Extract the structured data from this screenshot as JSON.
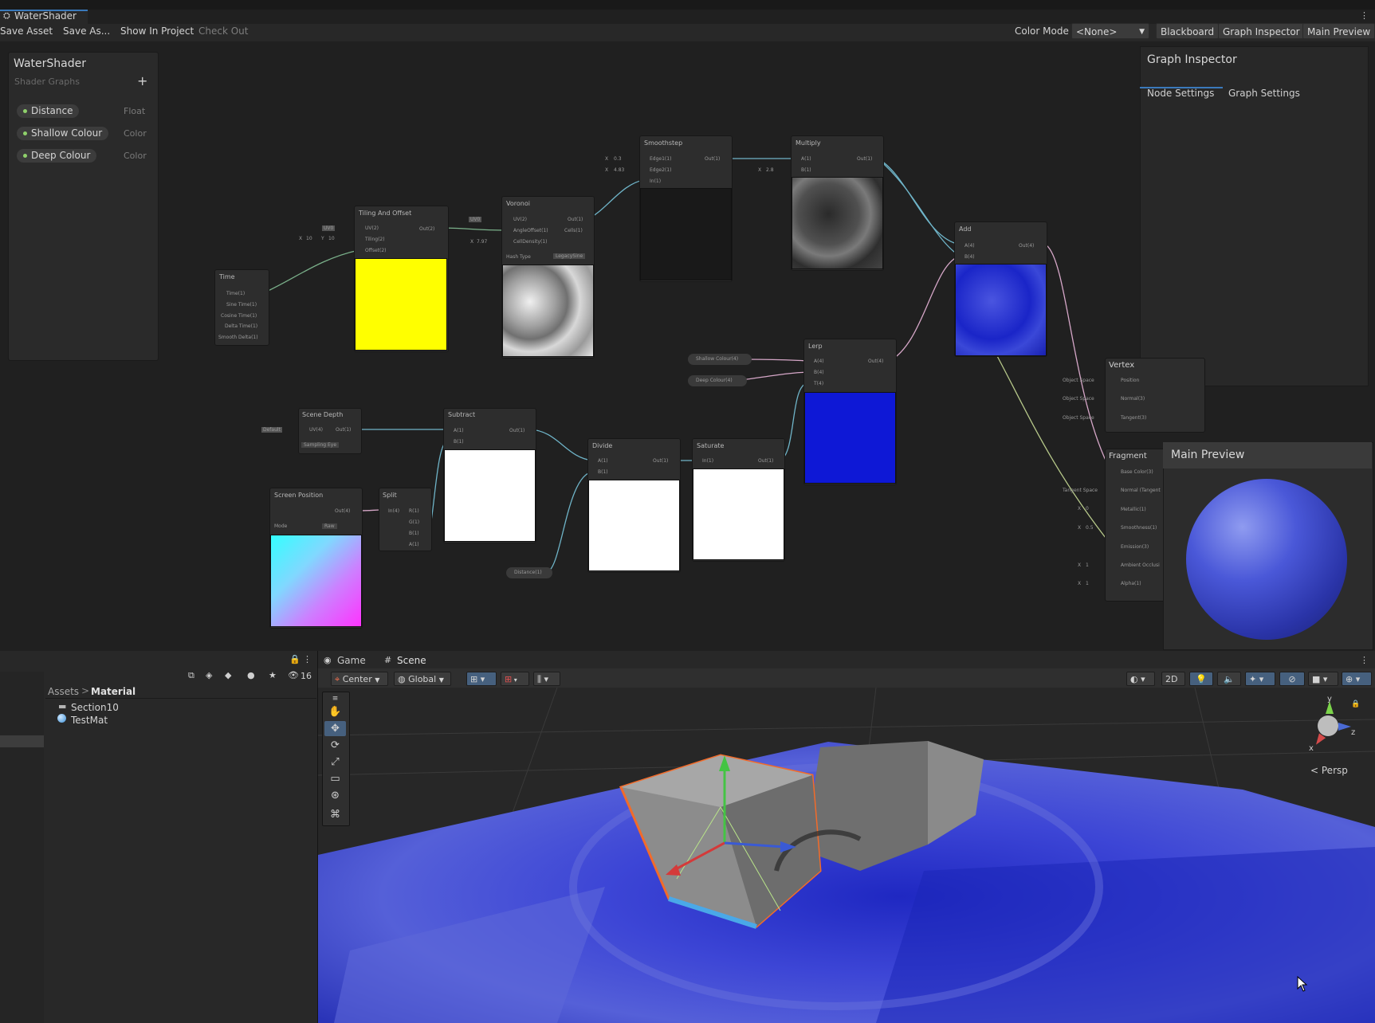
{
  "window": {
    "title": "WaterShader"
  },
  "toolbar": {
    "save_asset": "Save Asset",
    "save_as": "Save As...",
    "show_in_project": "Show In Project",
    "check_out": "Check Out",
    "color_mode_label": "Color Mode",
    "color_mode_value": "<None>",
    "blackboard": "Blackboard",
    "graph_inspector": "Graph Inspector",
    "main_preview": "Main Preview"
  },
  "blackboard": {
    "title": "WaterShader",
    "subtitle": "Shader Graphs",
    "add_icon": "+",
    "properties": [
      {
        "name": "Distance",
        "type": "Float"
      },
      {
        "name": "Shallow Colour",
        "type": "Color"
      },
      {
        "name": "Deep Colour",
        "type": "Color"
      }
    ]
  },
  "graph_inspector": {
    "title": "Graph Inspector",
    "tabs": [
      "Node Settings",
      "Graph Settings"
    ]
  },
  "nodes": {
    "time": {
      "title": "Time",
      "ports": [
        "Time(1)",
        "Sine Time(1)",
        "Cosine Time(1)",
        "Delta Time(1)",
        "Smooth Delta(1)"
      ]
    },
    "tiling": {
      "title": "Tiling And Offset",
      "ports": [
        "UV(2)",
        "Tiling(2)",
        "Offset(2)"
      ],
      "out": "Out(2)",
      "uv": "UV0",
      "x": "X",
      "x_val": "10",
      "y": "Y",
      "y_val": "10"
    },
    "voronoi": {
      "title": "Voronoi",
      "ports": [
        "UV(2)",
        "AngleOffset(1)",
        "CellDensity(1)"
      ],
      "outs": [
        "Out(1)",
        "Cells(1)"
      ],
      "uv": "UV0",
      "x": "X",
      "x_val": "7.97",
      "hash_label": "Hash Type",
      "hash_value": "LegacySine"
    },
    "smoothstep": {
      "title": "Smoothstep",
      "ports": [
        "Edge1(1)",
        "Edge2(1)",
        "In(1)"
      ],
      "out": "Out(1)",
      "x": "X",
      "e1": "0.3",
      "e2": "4.83"
    },
    "multiply": {
      "title": "Multiply",
      "ports": [
        "A(1)",
        "B(1)"
      ],
      "out": "Out(1)",
      "x": "X",
      "b": "2.8"
    },
    "add": {
      "title": "Add",
      "ports": [
        "A(4)",
        "B(4)"
      ],
      "out": "Out(4)"
    },
    "lerp": {
      "title": "Lerp",
      "ports": [
        "A(4)",
        "B(4)",
        "T(4)"
      ],
      "out": "Out(4)"
    },
    "shallow_prop": "Shallow Colour(4)",
    "deep_prop": "Deep Colour(4)",
    "scene_depth": {
      "title": "Scene Depth",
      "sampling": "Default",
      "port": "UV(4)",
      "out": "Out(1)",
      "mode": "Sampling Eye"
    },
    "subtract": {
      "title": "Subtract",
      "ports": [
        "A(1)",
        "B(1)"
      ],
      "out": "Out(1)"
    },
    "screen_pos": {
      "title": "Screen Position",
      "out": "Out(4)",
      "mode_label": "Mode",
      "mode_value": "Raw"
    },
    "split": {
      "title": "Split",
      "in": "In(4)",
      "outs": [
        "R(1)",
        "G(1)",
        "B(1)",
        "A(1)"
      ]
    },
    "divide": {
      "title": "Divide",
      "ports": [
        "A(1)",
        "B(1)"
      ],
      "out": "Out(1)"
    },
    "saturate": {
      "title": "Saturate",
      "ports": [
        "In(1)"
      ],
      "out": "Out(1)"
    },
    "distance_prop": "Distance(1)",
    "vertex": {
      "title": "Vertex",
      "spaces": [
        "Object Space",
        "Object Space",
        "Object Space"
      ],
      "ports": [
        "Position",
        "Normal(3)",
        "Tangent(3)"
      ]
    },
    "fragment": {
      "title": "Fragment",
      "ports": [
        "Base Color(3)",
        "Normal (Tangent",
        "Metallic(1)",
        "Smoothness(1)",
        "Emission(3)",
        "Ambient Occlusi",
        "Alpha(1)"
      ],
      "space": "Tangent Space",
      "x": "X",
      "vals": [
        "0",
        "0.5",
        "1",
        "1"
      ]
    }
  },
  "main_preview": {
    "title": "Main Preview"
  },
  "project": {
    "breadcrumb_root": "Assets",
    "breadcrumb_sep": ">",
    "breadcrumb_current": "Material",
    "items": [
      {
        "name": "Section10",
        "icon": "folder-icon"
      },
      {
        "name": "TestMat",
        "icon": "material-icon"
      }
    ],
    "hidden_count": "16"
  },
  "scene": {
    "tabs": [
      "Game",
      "Scene"
    ],
    "pivot": "Center",
    "space": "Global",
    "mode_2d": "2D",
    "persp": "Persp",
    "axis_y": "y",
    "axis_z": "z",
    "axis_x": "x"
  },
  "colors": {
    "accent": "#3a79bb",
    "water_blue": "#3d46d6",
    "selection_orange": "#f26b2a",
    "yellow_preview": "#ffff00",
    "deep_blue": "#0e18d6"
  }
}
